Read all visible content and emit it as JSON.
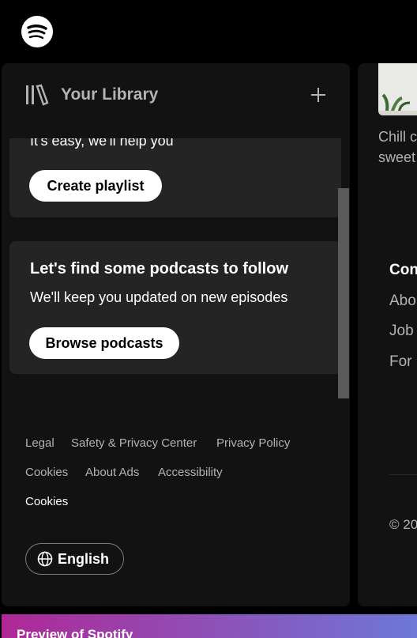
{
  "header": {
    "logo_icon": "spotify-logo-icon"
  },
  "library": {
    "title": "Your Library",
    "library_icon": "library-icon",
    "add_icon": "plus-icon",
    "playlist_card": {
      "subtitle": "It's easy, we'll help you",
      "button_label": "Create playlist"
    },
    "podcast_card": {
      "title": "Let's find some podcasts to follow",
      "subtitle": "We'll keep you updated on new episodes",
      "button_label": "Browse podcasts"
    },
    "footer_links": [
      "Legal",
      "Safety & Privacy Center",
      "Privacy Policy",
      "Cookies",
      "About Ads",
      "Accessibility",
      "Cookies"
    ],
    "language_button": "English",
    "language_icon": "globe-icon"
  },
  "right_panel": {
    "card_text_line1": "Chill c",
    "card_text_line2": "sweet",
    "section_heading": "Con",
    "links": [
      "Abo",
      "Job",
      "For"
    ],
    "copyright": "© 20"
  },
  "preview_bar": {
    "text": "Preview of Spotify"
  },
  "colors": {
    "background": "#000000",
    "panel": "#121212",
    "card": "#242424",
    "accent_gradient_start": "#af2896"
  }
}
